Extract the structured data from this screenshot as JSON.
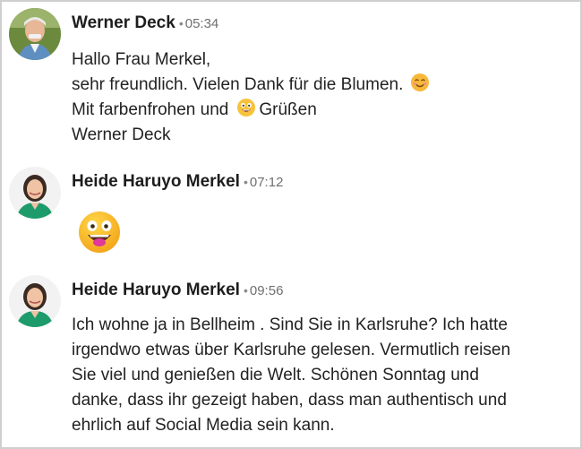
{
  "messages": [
    {
      "author": "Werner Deck",
      "separator": "•",
      "time": "05:34",
      "lines": [
        "Hallo Frau Merkel,",
        "sehr freundlich. Vielen Dank für die Blumen.",
        "Mit farbenfrohen und",
        "Grüßen",
        "Werner Deck"
      ]
    },
    {
      "author": "Heide Haruyo Merkel",
      "separator": "•",
      "time": "07:12",
      "emoji": "grinning-face-with-tongue"
    },
    {
      "author": "Heide Haruyo Merkel",
      "separator": "•",
      "time": "09:56",
      "lines": [
        "Ich wohne ja in Bellheim . Sind Sie in Karlsruhe? Ich hatte",
        "irgendwo etwas über Karlsruhe gelesen. Vermutlich reisen",
        "Sie viel und genießen die Welt. Schönen Sonntag und",
        "danke, dass ihr gezeigt haben, dass man authentisch und",
        "ehrlich auf Social Media sein kann."
      ]
    }
  ],
  "colors": {
    "emoji_yellow": "#f9c21b",
    "emoji_orange": "#f3a317",
    "green_shirt": "#1e9b6b"
  }
}
